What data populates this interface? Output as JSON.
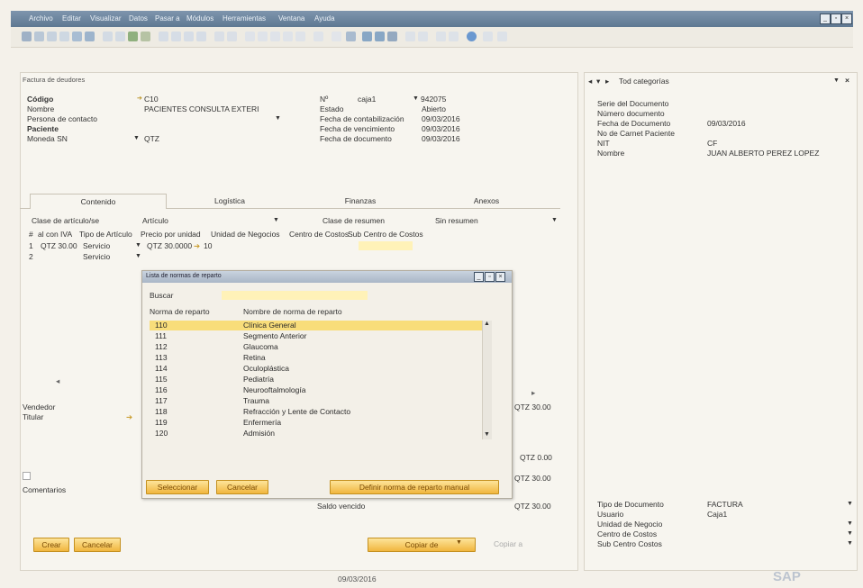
{
  "menu": [
    "Archivo",
    "Editar",
    "Visualizar",
    "Datos",
    "Pasar a",
    "Módulos",
    "Herramientas",
    "Ventana",
    "Ayuda"
  ],
  "form": {
    "title": "Factura de deudores",
    "codigo_label": "Código",
    "codigo_value": "C10",
    "nombre_label": "Nombre",
    "nombre_value": "PACIENTES CONSULTA EXTERI",
    "persona_label": "Persona de contacto",
    "paciente_label": "Paciente",
    "moneda_label": "Moneda SN",
    "moneda_value": "QTZ",
    "n_label": "Nº",
    "n_series": "caja1",
    "n_value": "942075",
    "estado_label": "Estado",
    "estado_value": "Abierto",
    "fcont_label": "Fecha de contabilización",
    "fcont_value": "09/03/2016",
    "fvenc_label": "Fecha de vencimiento",
    "fvenc_value": "09/03/2016",
    "fdoc_label": "Fecha de documento",
    "fdoc_value": "09/03/2016"
  },
  "tabs": [
    "Contenido",
    "Logística",
    "Finanzas",
    "Anexos"
  ],
  "content": {
    "clase_label": "Clase de artículo/se",
    "clase_value": "Artículo",
    "resumen_label": "Clase de resumen",
    "resumen_value": "Sin resumen",
    "headers": [
      "#",
      "al con IVA",
      "Tipo de Artículo",
      "Precio por unidad",
      "Unidad de Negocios",
      "Centro de Costos",
      "Sub Centro de Costos"
    ],
    "row1": {
      "num": "1",
      "total": "QTZ 30.00",
      "tipo": "Servicio",
      "precio": "QTZ 30.0000",
      "unidad": "10"
    },
    "row2": {
      "num": "2",
      "tipo": "Servicio"
    }
  },
  "lower": {
    "vendedor_label": "Vendedor",
    "titular_label": "Titular",
    "comentarios_label": "Comentarios",
    "total1": "QTZ 30.00",
    "total2": "QTZ 0.00",
    "total3": "QTZ 30.00",
    "total4": "QTZ 30.00",
    "saldo_label": "Saldo vencido"
  },
  "dialog": {
    "title": "Lista de normas de reparto",
    "buscar_label": "Buscar",
    "col1": "Norma de reparto",
    "col2": "Nombre de norma de reparto",
    "rows": [
      {
        "code": "110",
        "name": "Clínica General"
      },
      {
        "code": "111",
        "name": "Segmento Anterior"
      },
      {
        "code": "112",
        "name": "Glaucoma"
      },
      {
        "code": "113",
        "name": "Retina"
      },
      {
        "code": "114",
        "name": "Oculoplástica"
      },
      {
        "code": "115",
        "name": "Pediatría"
      },
      {
        "code": "116",
        "name": "Neurooftalmología"
      },
      {
        "code": "117",
        "name": "Trauma"
      },
      {
        "code": "118",
        "name": "Refracción y Lente de Contacto"
      },
      {
        "code": "119",
        "name": "Enfermería"
      },
      {
        "code": "120",
        "name": "Admisión"
      }
    ],
    "select_btn": "Seleccionar",
    "cancel_btn": "Cancelar",
    "define_btn": "Definir norma de reparto manual"
  },
  "bottom": {
    "create": "Crear",
    "cancel": "Cancelar",
    "copy_from": "Copiar de",
    "copy_to": "Copiar a",
    "date": "09/03/2016",
    "logo": "SAP"
  },
  "right": {
    "category": "Tod categorías",
    "serie_label": "Serie del Documento",
    "numero_label": "Número documento",
    "fecha_label": "Fecha de Documento",
    "fecha_value": "09/03/2016",
    "carnet_label": "No de Carnet Paciente",
    "nit_label": "NIT",
    "nit_value": "CF",
    "nombre_label": "Nombre",
    "nombre_value": "JUAN ALBERTO PEREZ LOPEZ",
    "tipo_label": "Tipo de Documento",
    "tipo_value": "FACTURA",
    "usuario_label": "Usuario",
    "usuario_value": "Caja1",
    "unidad_label": "Unidad de Negocio",
    "centro_label": "Centro de Costos",
    "sub_label": "Sub Centro Costos"
  }
}
